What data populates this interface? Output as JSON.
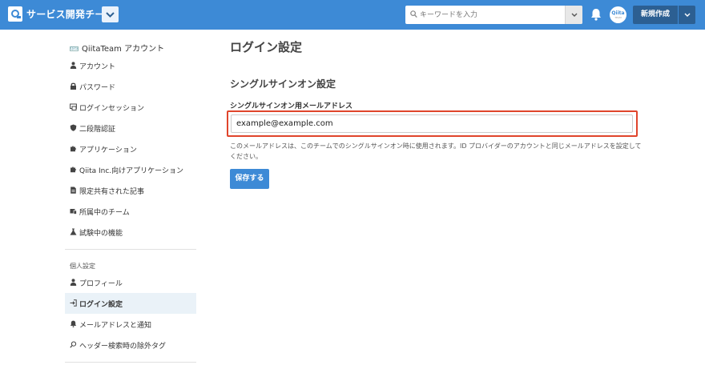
{
  "header": {
    "team_name": "サービス開発チーム",
    "search_placeholder": "キーワードを入力",
    "new_post_label": "新規作成",
    "avatar_text": "Qiita",
    "avatar_sub": "TEAM",
    "brand_color": "#3d8ad6",
    "dark_button_color": "#2c5f92"
  },
  "sidebar": {
    "account_title": "QiitaTeam アカウント",
    "account_logo_text": "Qiita",
    "team_items": [
      {
        "label": "アカウント",
        "icon": "person-icon"
      },
      {
        "label": "パスワード",
        "icon": "lock-icon"
      },
      {
        "label": "ログインセッション",
        "icon": "session-icon"
      },
      {
        "label": "二段階認証",
        "icon": "shield-icon"
      },
      {
        "label": "アプリケーション",
        "icon": "puzzle-icon"
      },
      {
        "label": "Qiita Inc.向けアプリケーション",
        "icon": "puzzle-icon"
      },
      {
        "label": "限定共有された記事",
        "icon": "document-icon"
      },
      {
        "label": "所属中のチーム",
        "icon": "team-icon"
      },
      {
        "label": "試験中の機能",
        "icon": "flask-icon"
      }
    ],
    "personal_section": "個人設定",
    "personal_items": [
      {
        "label": "プロフィール",
        "icon": "person-icon"
      },
      {
        "label": "ログイン設定",
        "icon": "login-icon",
        "active": true
      },
      {
        "label": "メールアドレスと通知",
        "icon": "bell-icon"
      },
      {
        "label": "ヘッダー検索時の除外タグ",
        "icon": "tag-search-icon"
      }
    ]
  },
  "main": {
    "page_title": "ログイン設定",
    "section_title": "シングルサインオン設定",
    "field_label": "シングルサインオン用メールアドレス",
    "email_value": "example@example.com",
    "help_text": "このメールアドレスは、このチームでのシングルサインオン時に使用されます。ID プロバイダーのアカウントと同じメールアドレスを設定してください。",
    "save_label": "保存する",
    "highlight_color": "#e0452c"
  }
}
